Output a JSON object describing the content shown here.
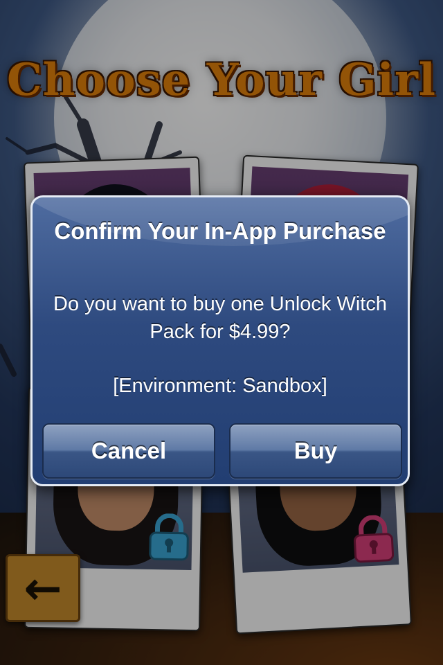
{
  "screen": {
    "title": "Choose Your Girl"
  },
  "dialog": {
    "title": "Confirm Your In-App Purchase",
    "message": "Do you want to buy one Unlock Witch Pack for $4.99?",
    "environment": "[Environment: Sandbox]",
    "cancel_label": "Cancel",
    "buy_label": "Buy"
  },
  "icons": {
    "back": "left-arrow-icon",
    "lock": "padlock-icon"
  },
  "colors": {
    "title_orange": "#e2820c",
    "dialog_blue": "#2e4a7f",
    "lock_blue": "#3ba6d6",
    "lock_pink": "#d8407a",
    "sign_wood": "#c58b2c"
  }
}
